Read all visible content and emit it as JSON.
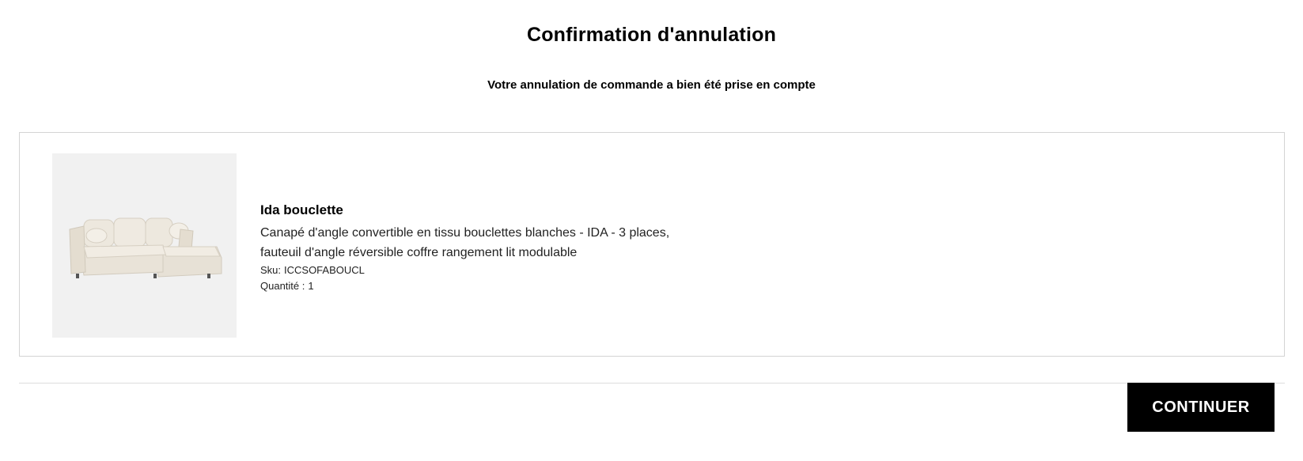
{
  "header": {
    "title": "Confirmation d'annulation",
    "subtitle": "Votre annulation de commande a bien été prise en compte"
  },
  "order": {
    "items": [
      {
        "name": "Ida bouclette",
        "description": "Canapé d'angle convertible en tissu bouclettes blanches - IDA - 3 places, fauteuil d'angle réversible coffre rangement lit modulable",
        "sku_label": "Sku:",
        "sku": "ICCSOFABOUCL",
        "quantity_label": "Quantité :",
        "quantity": "1",
        "image_icon": "sofa-image"
      }
    ]
  },
  "actions": {
    "continue_label": "CONTINUER"
  },
  "colors": {
    "accent": "#000000",
    "card_border": "#d4d4d4",
    "image_bg": "#f1f1f1"
  }
}
